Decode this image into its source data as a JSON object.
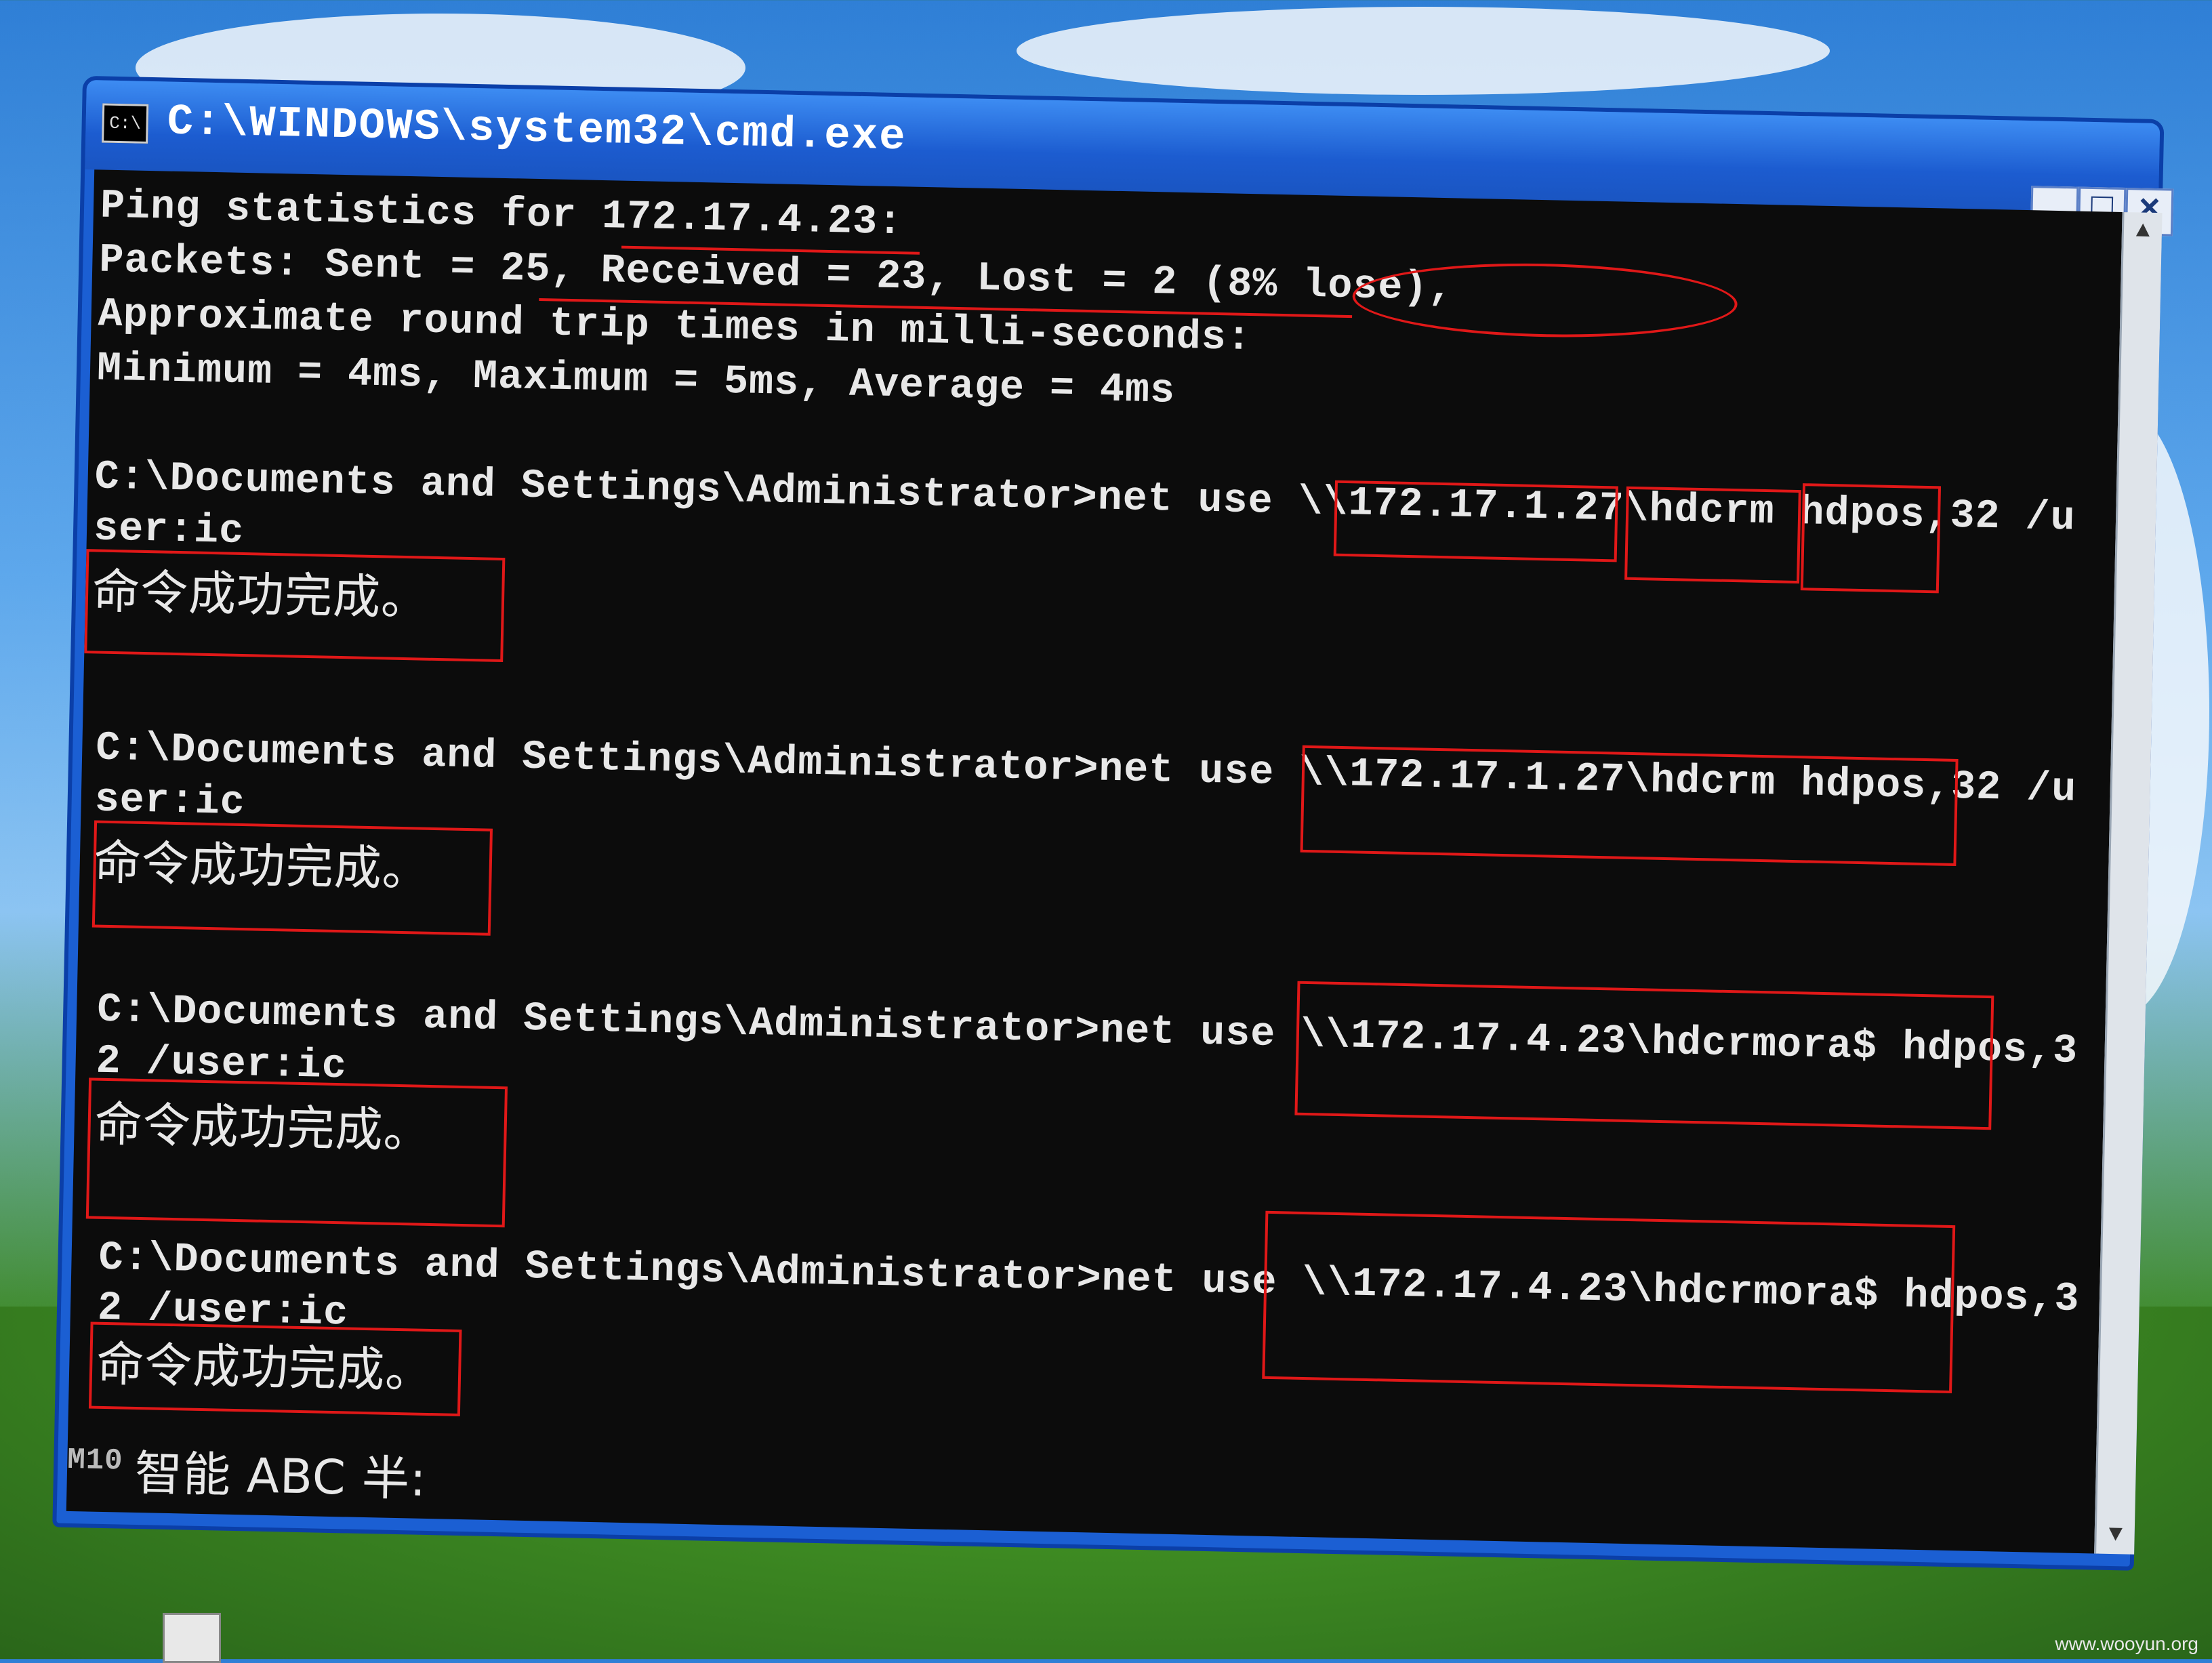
{
  "window": {
    "title": "C:\\WINDOWS\\system32\\cmd.exe",
    "icon": "cmd-icon",
    "icon_text": "C:\\",
    "buttons": {
      "minimize": "_",
      "maximize": "□",
      "close": "×"
    }
  },
  "console": {
    "ping_header": "Ping statistics for 172.17.4.23:",
    "packets": "    Packets: Sent = 25, Received = 23, Lost = 2 (8% lose),",
    "rtt_header": "Approximate round trip times in milli-seconds:",
    "rtt_values": "    Minimum = 4ms, Maximum = 5ms, Average = 4ms",
    "commands": [
      {
        "prompt": "C:\\Documents and Settings\\Administrator>net use \\\\172.17.1.27\\hdcrm  hdpos,32 /u",
        "cont": "ser:ic",
        "result": "命令成功完成。"
      },
      {
        "prompt": "C:\\Documents and Settings\\Administrator>net use \\\\172.17.1.27\\hdcrm  hdpos,32 /u",
        "cont": "ser:ic",
        "result": "命令成功完成。"
      },
      {
        "prompt": "C:\\Documents and Settings\\Administrator>net use \\\\172.17.4.23\\hdcrmora$  hdpos,3",
        "cont": "2 /user:ic",
        "result": "命令成功完成。"
      },
      {
        "prompt": "C:\\Documents and Settings\\Administrator>net use \\\\172.17.4.23\\hdcrmora$  hdpos,3",
        "cont": "2 /user:ic",
        "result": "命令成功完成。"
      }
    ],
    "ime_bar": "智能 ABC 半:",
    "ime_prefix": "M10"
  },
  "scrollbar": {
    "up": "▲",
    "down": "▼"
  },
  "watermark": "www.wooyun.org",
  "colors": {
    "console_bg": "#0c0c0c",
    "console_text": "#e8e8e8",
    "annotation": "#e01818",
    "titlebar": "#1c5cd0"
  }
}
